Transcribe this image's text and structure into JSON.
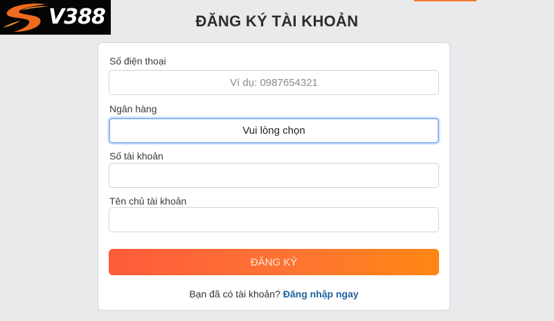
{
  "brand": {
    "logo_text": "V388",
    "colors": {
      "logo_bg": "#050505",
      "swoosh": "#ef6a1d",
      "swoosh_light": "#f79432"
    }
  },
  "header": {
    "title": "ĐĂNG KÝ TÀI KHOẢN"
  },
  "form": {
    "phone": {
      "label": "Số điện thoại",
      "placeholder": "Ví dụ: 0987654321",
      "value": ""
    },
    "bank": {
      "label": "Ngân hàng",
      "selected": "Vui lòng chọn"
    },
    "account_number": {
      "label": "Số tài khoản",
      "value": ""
    },
    "account_name": {
      "label": "Tên chủ tài khoản",
      "value": ""
    },
    "submit_label": "ĐĂNG KÝ",
    "submit_colors": [
      "#ff5b3a",
      "#ff8712"
    ]
  },
  "footer": {
    "prompt": "Bạn đã có tài khoản?",
    "login_link": "Đăng nhập ngay"
  }
}
